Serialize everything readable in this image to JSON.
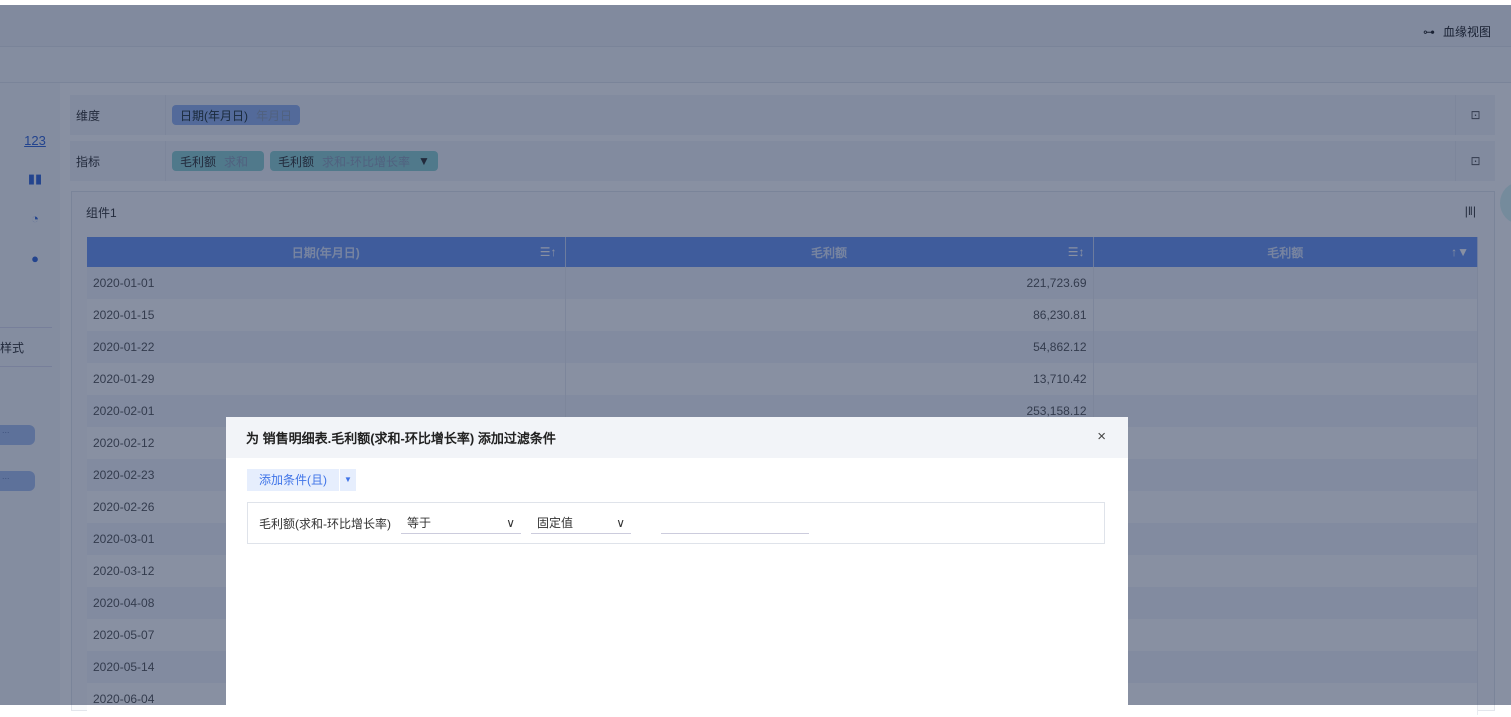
{
  "header": {
    "lineage_label": "血缘视图"
  },
  "sidebar": {
    "tab_style": "样式",
    "items": [
      "123"
    ],
    "buttons": [
      "...",
      "..."
    ]
  },
  "fields": {
    "dimension_label": "维度",
    "metric_label": "指标",
    "dimension_pills": [
      {
        "name": "日期(年月日)",
        "sub": "年月日"
      }
    ],
    "metric_pills": [
      {
        "name": "毛利额",
        "sub": "求和"
      },
      {
        "name": "毛利额",
        "sub": "求和-环比增长率"
      }
    ]
  },
  "component": {
    "title": "组件1",
    "columns": [
      "日期(年月日)",
      "毛利额",
      "毛利额"
    ],
    "rows": [
      [
        "2020-01-01",
        "221,723.69",
        ""
      ],
      [
        "2020-01-15",
        "86,230.81",
        ""
      ],
      [
        "2020-01-22",
        "54,862.12",
        ""
      ],
      [
        "2020-01-29",
        "13,710.42",
        ""
      ],
      [
        "2020-02-01",
        "253,158.12",
        ""
      ],
      [
        "2020-02-12",
        "",
        ""
      ],
      [
        "2020-02-23",
        "",
        ""
      ],
      [
        "2020-02-26",
        "",
        ""
      ],
      [
        "2020-03-01",
        "",
        ""
      ],
      [
        "2020-03-12",
        "",
        ""
      ],
      [
        "2020-04-08",
        "",
        ""
      ],
      [
        "2020-05-07",
        "",
        ""
      ],
      [
        "2020-05-14",
        "",
        ""
      ],
      [
        "2020-06-04",
        "",
        ""
      ]
    ]
  },
  "dialog": {
    "title": "为 销售明细表.毛利额(求和-环比增长率) 添加过滤条件",
    "close": "×",
    "add_condition": "添加条件(且)",
    "dropdown_arrow": "▼",
    "condition": {
      "field": "毛利额(求和-环比增长率)",
      "operator": "等于",
      "value_type": "固定值",
      "value": "",
      "chevron": "∨"
    }
  }
}
